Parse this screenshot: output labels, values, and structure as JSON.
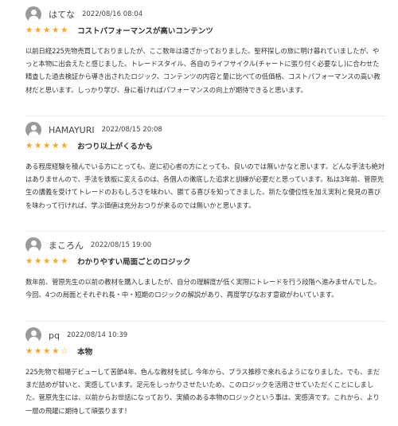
{
  "reviews": [
    {
      "reviewer": "はてな",
      "date": "2022/08/16 08:04",
      "rating": 5,
      "title": "コストパフォーマンスが高いコンテンツ",
      "body": "以前日経225先物売買しておりましたが、ここ数年は遠ざかっておりました。聖杯探しの旅に明け暮れていましたが、やっと本物に出会えたと感じました。トレードスタイル、各自のライフサイクル(チャートに張り付く必要なし)に合わせた精査した過去検証から導き出されたロジック、コンテンツの内容と量に比べての低価格、コストパフォーマンスの高い教材だと思います。しっかり学び、身に着ければパフォーマンスの向上が期待できると思います。"
    },
    {
      "reviewer": "HAMAYURI",
      "date": "2022/08/15 20:08",
      "rating": 5,
      "title": "おつり以上がくるかも",
      "body": "ある程度経験を積んでいる方にとっても、逆に初心者の方にとっても、良いのでは無いかなと思います。どんな手法も絶対はありませんので、手法を鉄板に変えるのは、各個人の徹底した追求と訓練が必要だと思っています。私は3年前、菅原先生の講義を受けてトレードのおもしろさを味わい、勝てる喜びを知ってきました。新たな優位性を加え実利と発見の喜びを味わって行ければ、学ぶ価値は充分おつりが来るのでは無いかと思います。"
    },
    {
      "reviewer": "まころん",
      "date": "2022/08/15 19:00",
      "rating": 5,
      "title": "わかりやすい局面ごとのロジック",
      "body": "数年前、菅原先生の以前の教材を購入しましたが、自分の理解度が低く実際にトレードを行う段階へ進みませんでした。今回、4つの局面とそれぞれ長・中・短期のロジックの解説があり、再度学びなおす意欲がわいています。"
    },
    {
      "reviewer": "pq",
      "date": "2022/08/14 10:39",
      "rating": 4,
      "title": "本物",
      "body": "225先物で相場デビューして苦節4年、色んな教材を試し 今年から、プラス推移で来れるようになりました。でも、まだまだ詰めが甘いと、実感しています。足元をしっかりさせたいため、このロジックを活用させていただくことにしました。菅原先生には、以前からお世話になっており、実績のある本物のロジックという事は、実感済です。これから、より一層の飛躍に期待して頑張ります！"
    }
  ]
}
